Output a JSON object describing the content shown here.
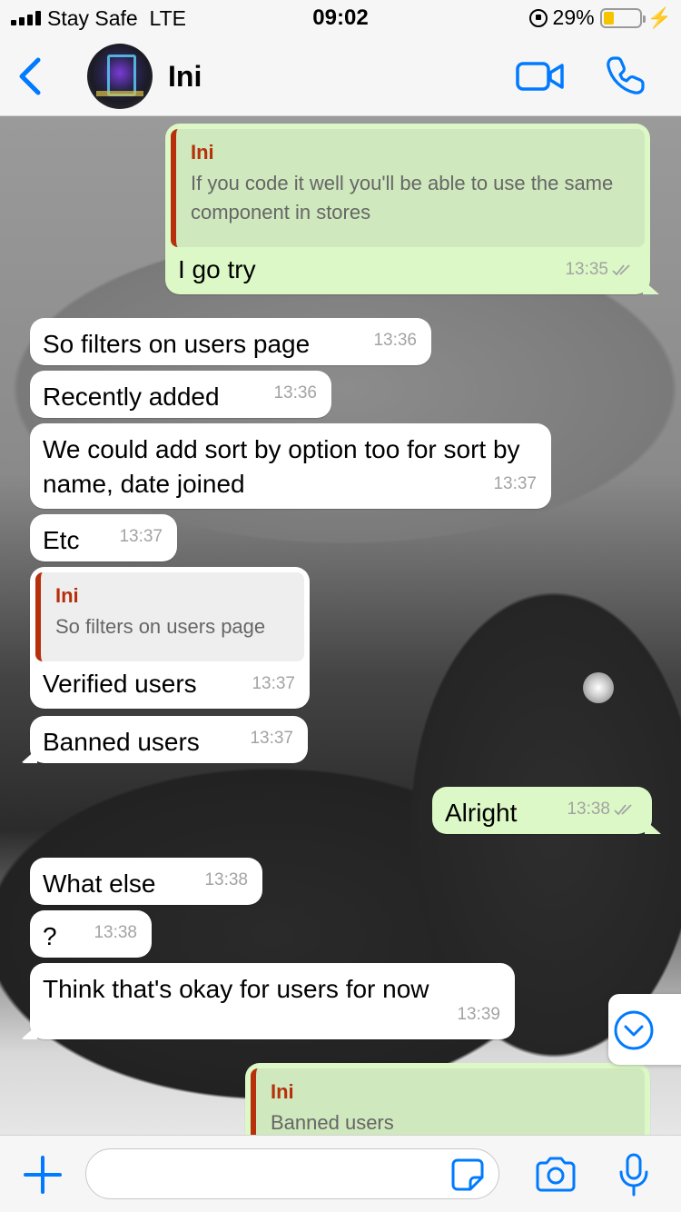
{
  "status_bar": {
    "carrier": "Stay Safe",
    "network": "LTE",
    "time": "09:02",
    "battery": "29%",
    "battery_level": 0.29,
    "icons": [
      "signal-icon",
      "orientation-lock-icon",
      "battery-icon",
      "charging-bolt-icon"
    ]
  },
  "header": {
    "contact_name": "Ini",
    "icons": [
      "back-chevron-icon",
      "avatar",
      "video-call-icon",
      "phone-call-icon"
    ]
  },
  "messages": [
    {
      "direction": "out",
      "quote_author": "Ini",
      "quote_text": "If you code it well you'll be able to use the same component in stores",
      "text": "I go try",
      "time": "13:35",
      "read": true
    },
    {
      "direction": "in",
      "text": "So filters on users page",
      "time": "13:36"
    },
    {
      "direction": "in",
      "text": "Recently added",
      "time": "13:36"
    },
    {
      "direction": "in",
      "text": "We could add sort by option too for sort by name, date joined",
      "time": "13:37"
    },
    {
      "direction": "in",
      "text": "Etc",
      "time": "13:37"
    },
    {
      "direction": "in",
      "quote_author": "Ini",
      "quote_text": "So filters on users page",
      "text": "Verified users",
      "time": "13:37"
    },
    {
      "direction": "in",
      "text": "Banned users",
      "time": "13:37"
    },
    {
      "direction": "out",
      "text": "Alright",
      "time": "13:38",
      "read": true
    },
    {
      "direction": "in",
      "text": "What else",
      "time": "13:38"
    },
    {
      "direction": "in",
      "text": "?",
      "time": "13:38"
    },
    {
      "direction": "in",
      "text": "Think that's okay for users for now",
      "time": "13:39"
    },
    {
      "direction": "out",
      "quote_author": "Ini",
      "quote_text": "Banned users",
      "partial": true
    }
  ],
  "input_bar": {
    "placeholder": "",
    "icons": [
      "plus-icon",
      "sticker-icon",
      "camera-icon",
      "microphone-icon"
    ]
  },
  "colors": {
    "accent": "#007aff",
    "out_bubble": "#dcf8c6",
    "in_bubble": "#ffffff",
    "quote_author": "#b72f0b"
  }
}
